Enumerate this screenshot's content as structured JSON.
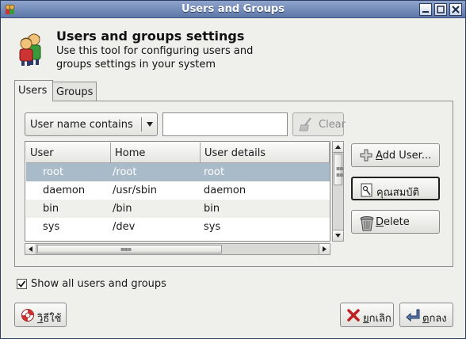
{
  "window": {
    "title": "Users and Groups",
    "controls": [
      "minimize-icon",
      "maximize-icon",
      "close-icon"
    ]
  },
  "header": {
    "title": "Users and groups settings",
    "description": "Use this tool for configuring users and groups settings in your system",
    "icon": "users-icon"
  },
  "tabs": [
    {
      "label": "Users",
      "active": true
    },
    {
      "label": "Groups",
      "active": false
    }
  ],
  "filter": {
    "selected": "User name contains",
    "value": "",
    "clear_label": "Clear"
  },
  "table": {
    "columns": [
      "User",
      "Home",
      "User details"
    ],
    "rows": [
      {
        "user": "root",
        "home": "/root",
        "details": "root",
        "selected": true
      },
      {
        "user": "daemon",
        "home": "/usr/sbin",
        "details": "daemon"
      },
      {
        "user": "bin",
        "home": "/bin",
        "details": "bin"
      },
      {
        "user": "sys",
        "home": "/dev",
        "details": "sys"
      }
    ]
  },
  "actions": {
    "add_user": "Add User...",
    "properties": "คุณสมบัติ",
    "delete": "Delete"
  },
  "show_all": {
    "label": "Show all users and groups",
    "checked": true
  },
  "footer": {
    "help": "วิธีใช้",
    "cancel": "ยกเลิก",
    "ok": "ตกลง"
  },
  "colors": {
    "titlebar": "#5d77a8",
    "selection": "#a9bac8",
    "window_bg": "#efefec"
  }
}
